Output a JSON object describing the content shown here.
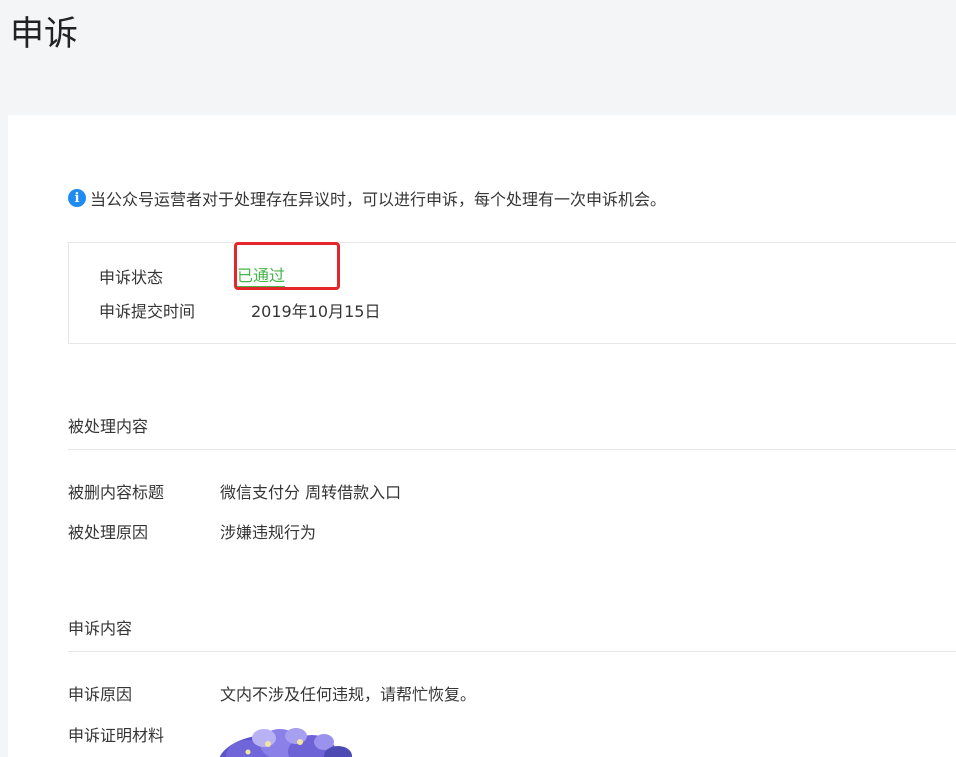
{
  "page": {
    "title": "申诉"
  },
  "notice": {
    "icon": "info-icon",
    "text": "当公众号运营者对于处理存在异议时，可以进行申诉，每个处理有一次申诉机会。"
  },
  "status": {
    "status_label": "申诉状态",
    "status_value": "已通过",
    "submit_time_label": "申诉提交时间",
    "submit_time_value": "2019年10月15日"
  },
  "processed_content": {
    "section_title": "被处理内容",
    "title_label": "被删内容标题",
    "title_value": "微信支付分 周转借款入口",
    "reason_label": "被处理原因",
    "reason_value": "涉嫌违规行为"
  },
  "appeal_content": {
    "section_title": "申诉内容",
    "reason_label": "申诉原因",
    "reason_value": "文内不涉及任何违规，请帮忙恢复。",
    "proof_label": "申诉证明材料"
  },
  "colors": {
    "accent_green": "#44b549",
    "info_blue": "#1e8cf0",
    "highlight_red": "#e5262a"
  }
}
